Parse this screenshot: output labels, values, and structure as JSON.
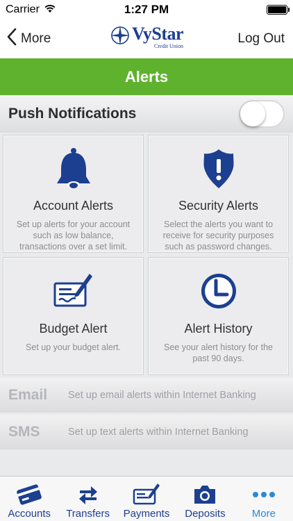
{
  "status_bar": {
    "carrier": "Carrier",
    "time": "1:27 PM"
  },
  "nav": {
    "back_label": "More",
    "logout_label": "Log Out",
    "logo_name": "VyStar",
    "logo_sub": "Credit Union"
  },
  "header": {
    "title": "Alerts"
  },
  "push": {
    "label": "Push Notifications",
    "enabled": false
  },
  "tiles": [
    {
      "title": "Account Alerts",
      "desc": "Set up alerts for your account such as low balance, transactions over a set limit.",
      "icon": "bell-icon"
    },
    {
      "title": "Security Alerts",
      "desc": "Select the alerts you want to receive for security purposes such as password changes.",
      "icon": "shield-icon"
    },
    {
      "title": "Budget Alert",
      "desc": "Set up your budget alert.",
      "icon": "check-pen-icon"
    },
    {
      "title": "Alert History",
      "desc": "See your alert history for the past 90 days.",
      "icon": "clock-icon"
    }
  ],
  "email": {
    "title": "Email",
    "desc": "Set up email alerts within Internet Banking"
  },
  "sms": {
    "title": "SMS",
    "desc": "Set up text alerts within Internet Banking"
  },
  "tabs": [
    {
      "label": "Accounts",
      "icon": "card-icon"
    },
    {
      "label": "Transfers",
      "icon": "transfer-arrows-icon"
    },
    {
      "label": "Payments",
      "icon": "check-pen-icon"
    },
    {
      "label": "Deposits",
      "icon": "camera-icon"
    },
    {
      "label": "More",
      "icon": "more-dots-icon"
    }
  ],
  "colors": {
    "brand_blue": "#1c3f8f",
    "header_green": "#5fb22d",
    "active_tab": "#2a8ad4"
  }
}
